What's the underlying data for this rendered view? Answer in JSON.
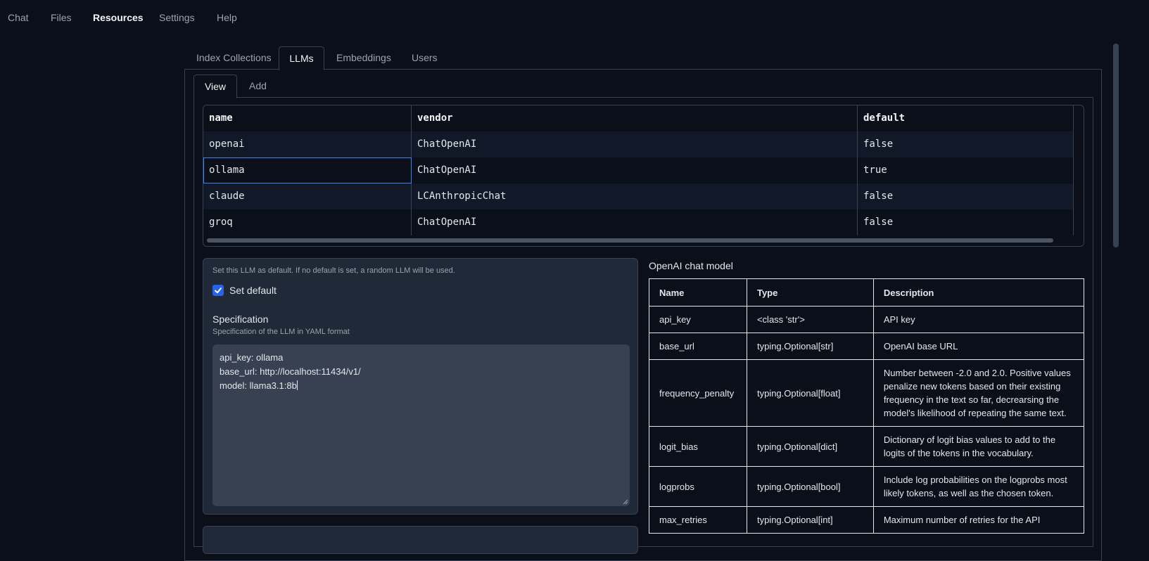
{
  "nav": {
    "items": [
      {
        "label": "Chat",
        "active": false
      },
      {
        "label": "Files",
        "active": false
      },
      {
        "label": "Resources",
        "active": true
      },
      {
        "label": "Settings",
        "active": false
      },
      {
        "label": "Help",
        "active": false
      }
    ]
  },
  "resource_tabs": [
    {
      "label": "Index Collections",
      "active": false
    },
    {
      "label": "LLMs",
      "active": true
    },
    {
      "label": "Embeddings",
      "active": false
    },
    {
      "label": "Users",
      "active": false
    }
  ],
  "llm_tabs": [
    {
      "label": "View",
      "active": true
    },
    {
      "label": "Add",
      "active": false
    }
  ],
  "llm_table": {
    "columns": [
      "name",
      "vendor",
      "default"
    ],
    "rows": [
      [
        "openai",
        "ChatOpenAI",
        "false"
      ],
      [
        "ollama",
        "ChatOpenAI",
        "true"
      ],
      [
        "claude",
        "LCAnthropicChat",
        "false"
      ],
      [
        "groq",
        "ChatOpenAI",
        "false"
      ]
    ],
    "selected_row": 1
  },
  "form": {
    "default_info": "Set this LLM as default. If no default is set, a random LLM will be used.",
    "set_default_label": "Set default",
    "set_default_checked": true,
    "spec_label": "Specification",
    "spec_info": "Specification of the LLM in YAML format",
    "spec_lines": [
      "api_key: ollama",
      "base_url: http://localhost:11434/v1/",
      "model: llama3.1:8b"
    ]
  },
  "model_doc": {
    "title": "OpenAI chat model",
    "columns": [
      "Name",
      "Type",
      "Description"
    ],
    "rows": [
      [
        "api_key",
        "<class 'str'>",
        "API key"
      ],
      [
        "base_url",
        "typing.Optional[str]",
        "OpenAI base URL"
      ],
      [
        "frequency_penalty",
        "typing.Optional[float]",
        "Number between -2.0 and 2.0. Positive values penalize new tokens based on their existing frequency in the text so far, decrearsing the model's likelihood of repeating the same text."
      ],
      [
        "logit_bias",
        "typing.Optional[dict]",
        "Dictionary of logit bias values to add to the logits of the tokens in the vocabulary."
      ],
      [
        "logprobs",
        "typing.Optional[bool]",
        "Include log probabilities on the logprobs most likely tokens, as well as the chosen token."
      ],
      [
        "max_retries",
        "typing.Optional[int]",
        "Maximum number of retries for the API"
      ]
    ]
  },
  "colors": {
    "accent": "#2563eb",
    "selection": "#3b82f6",
    "background": "#0b0f19",
    "card": "#1f2937"
  }
}
